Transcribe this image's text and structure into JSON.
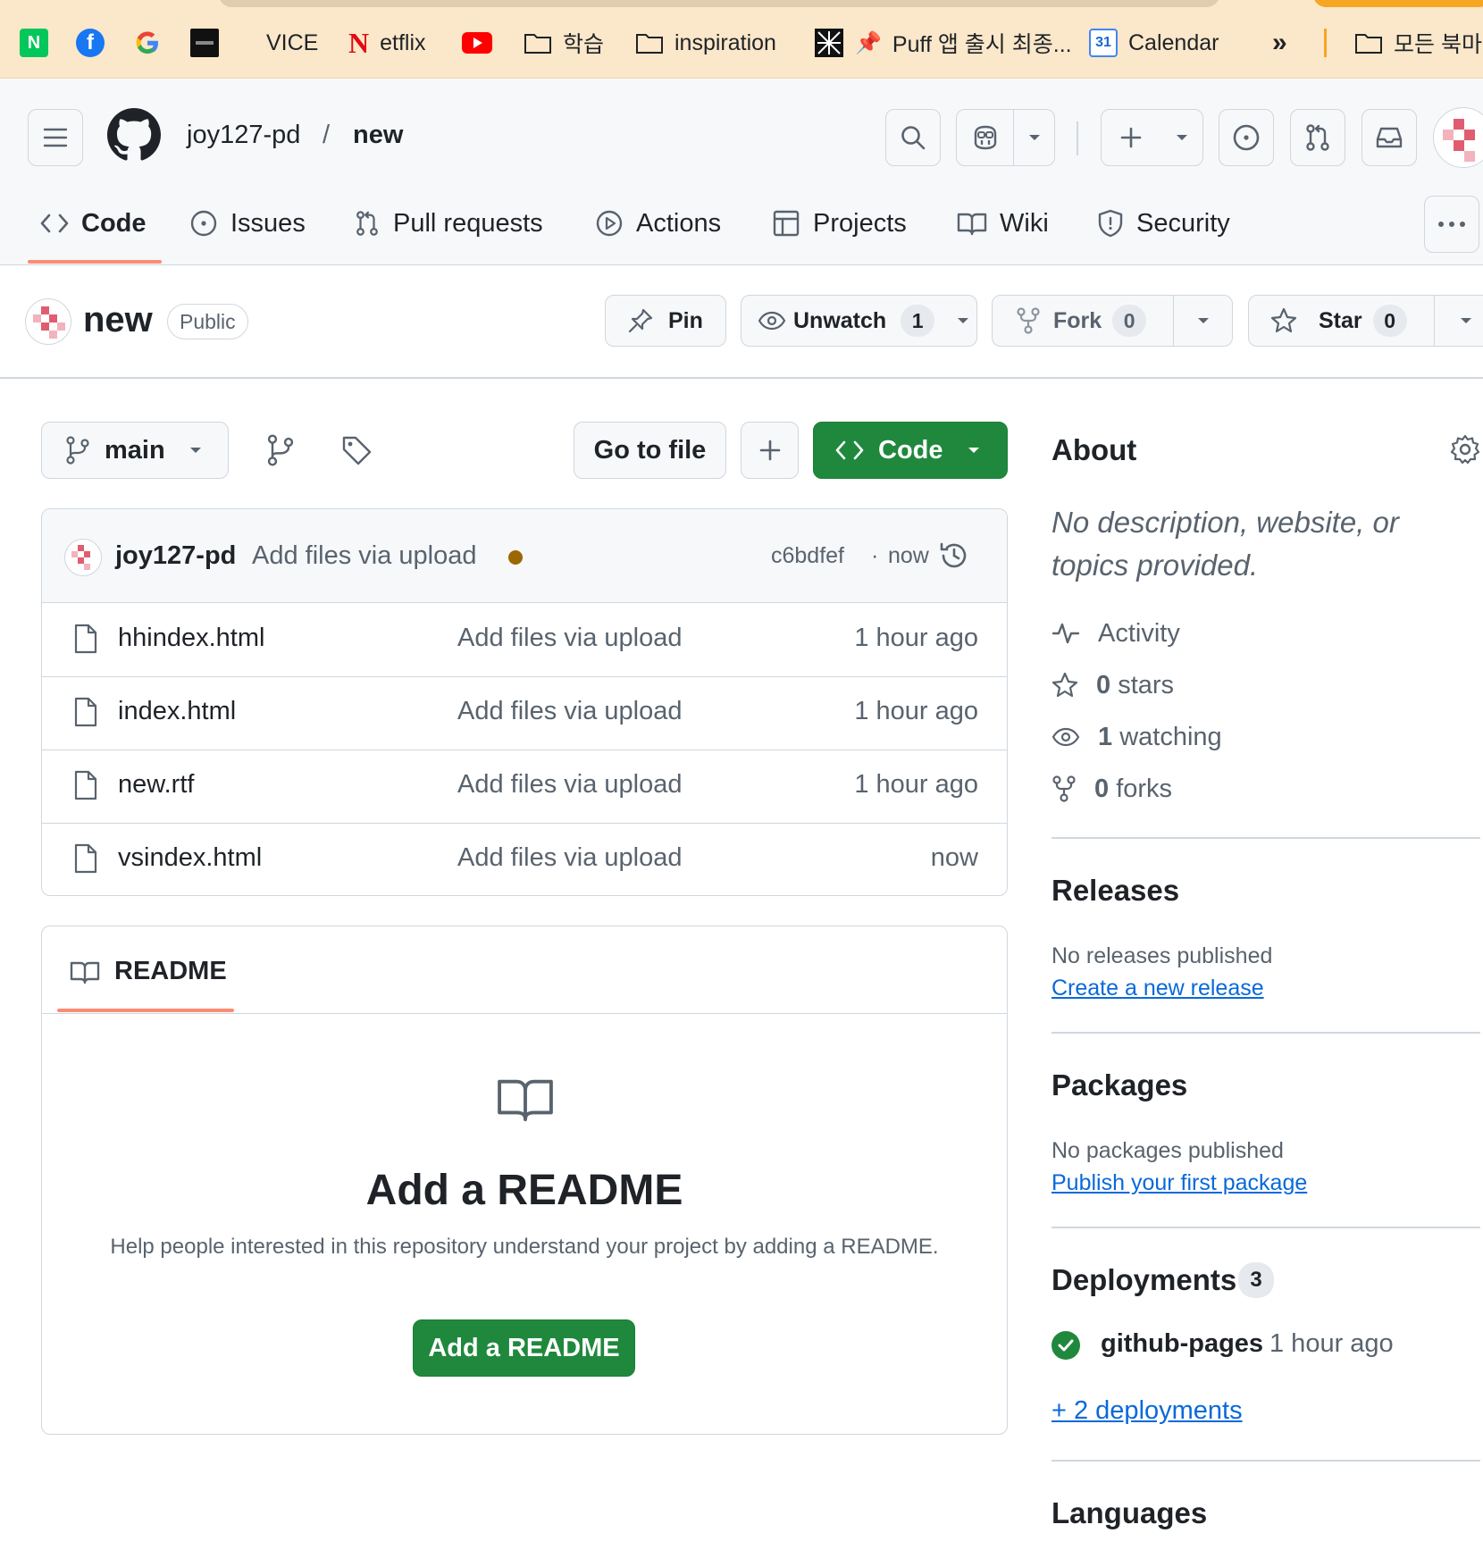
{
  "bookmarks": [
    {
      "label": "",
      "icon": "naver-icon"
    },
    {
      "label": "",
      "icon": "facebook-icon"
    },
    {
      "label": "",
      "icon": "google-icon"
    },
    {
      "label": "",
      "icon": "dark-site-icon"
    },
    {
      "label": "VICE",
      "icon": ""
    },
    {
      "label": "etflix",
      "icon": "netflix-icon"
    },
    {
      "label": "",
      "icon": "youtube-icon"
    },
    {
      "label": "학습",
      "icon": "folder-icon"
    },
    {
      "label": "inspiration",
      "icon": "folder-icon"
    },
    {
      "label": "",
      "icon": "pattern-icon"
    },
    {
      "label": "Puff 앱 출시 최종...",
      "icon": "pin-icon"
    },
    {
      "label": "Calendar",
      "icon": "calendar-icon",
      "day": "31"
    },
    {
      "label": "»",
      "icon": ""
    },
    {
      "label": "모든 북마크",
      "icon": "folder-icon"
    }
  ],
  "header": {
    "owner": "joy127-pd",
    "separator": "/",
    "repo": "new"
  },
  "nav": {
    "code": "Code",
    "issues": "Issues",
    "pulls": "Pull requests",
    "actions": "Actions",
    "projects": "Projects",
    "wiki": "Wiki",
    "security": "Security"
  },
  "repo": {
    "name": "new",
    "visibility": "Public",
    "pin": "Pin",
    "unwatch": "Unwatch",
    "watch_count": "1",
    "fork": "Fork",
    "fork_count": "0",
    "star": "Star",
    "star_count": "0"
  },
  "toolbar": {
    "branch": "main",
    "go_to_file": "Go to file",
    "code": "Code"
  },
  "commit": {
    "author": "joy127-pd",
    "message": "Add files via upload",
    "sha": "c6bdfef",
    "dot": "·",
    "time": "now",
    "status_color": "#9a6700"
  },
  "files": [
    {
      "name": "hhindex.html",
      "message": "Add files via upload",
      "time": "1 hour ago"
    },
    {
      "name": "index.html",
      "message": "Add files via upload",
      "time": "1 hour ago"
    },
    {
      "name": "new.rtf",
      "message": "Add files via upload",
      "time": "1 hour ago"
    },
    {
      "name": "vsindex.html",
      "message": "Add files via upload",
      "time": "now"
    }
  ],
  "readme": {
    "tab": "README",
    "heading": "Add a README",
    "description": "Help people interested in this repository understand your project by adding a README.",
    "button": "Add a README"
  },
  "about": {
    "title": "About",
    "description": "No description, website, or topics provided.",
    "activity": "Activity",
    "stars_num": "0",
    "stars_label": "stars",
    "watching_num": "1",
    "watching_label": "watching",
    "forks_num": "0",
    "forks_label": "forks"
  },
  "releases": {
    "title": "Releases",
    "empty": "No releases published",
    "link": "Create a new release"
  },
  "packages": {
    "title": "Packages",
    "empty": "No packages published",
    "link": "Publish your first package"
  },
  "deployments": {
    "title": "Deployments",
    "count": "3",
    "env": "github-pages",
    "time": "1 hour ago",
    "more": "+ 2 deployments"
  },
  "languages": {
    "title": "Languages"
  },
  "colors": {
    "green": "#1f883d",
    "accent_underline": "#fd8c73",
    "link": "#0969da",
    "muted": "#59636e",
    "bookmark_bar": "#fbe7c9"
  }
}
